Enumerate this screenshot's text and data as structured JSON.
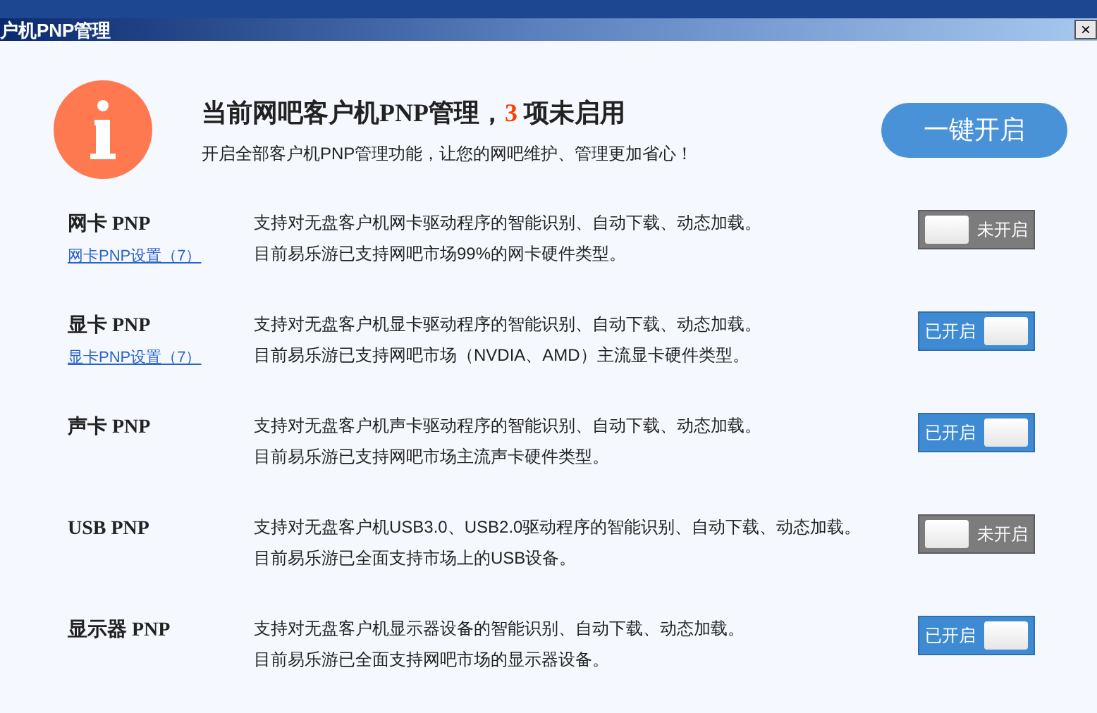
{
  "window": {
    "title": "户机PNP管理",
    "close": "×"
  },
  "header": {
    "title_before": "当前网吧客户机PNP管理，",
    "count": "3",
    "title_after": "项未启用",
    "subtitle": "开启全部客户机PNP管理功能，让您的网吧维护、管理更加省心！",
    "button": "一键开启"
  },
  "items": [
    {
      "name": "网卡 PNP",
      "link": "网卡PNP设置（7）",
      "lines": [
        "支持对无盘客户机网卡驱动程序的智能识别、自动下载、动态加载。",
        "目前易乐游已支持网吧市场99%的网卡硬件类型。"
      ],
      "on": false,
      "toggle_label": "未开启"
    },
    {
      "name": "显卡 PNP",
      "link": "显卡PNP设置（7）",
      "lines": [
        "支持对无盘客户机显卡驱动程序的智能识别、自动下载、动态加载。",
        "目前易乐游已支持网吧市场（NVDIA、AMD）主流显卡硬件类型。"
      ],
      "on": true,
      "toggle_label": "已开启"
    },
    {
      "name": "声卡 PNP",
      "lines": [
        "支持对无盘客户机声卡驱动程序的智能识别、自动下载、动态加载。",
        "目前易乐游已支持网吧市场主流声卡硬件类型。"
      ],
      "on": true,
      "toggle_label": "已开启"
    },
    {
      "name": "USB PNP",
      "lines": [
        "支持对无盘客户机USB3.0、USB2.0驱动程序的智能识别、自动下载、动态加载。",
        "目前易乐游已全面支持市场上的USB设备。"
      ],
      "on": false,
      "toggle_label": "未开启"
    },
    {
      "name": "显示器 PNP",
      "lines": [
        "支持对无盘客户机显示器设备的智能识别、自动下载、动态加载。",
        "目前易乐游已全面支持网吧市场的显示器设备。"
      ],
      "on": true,
      "toggle_label": "已开启"
    }
  ]
}
